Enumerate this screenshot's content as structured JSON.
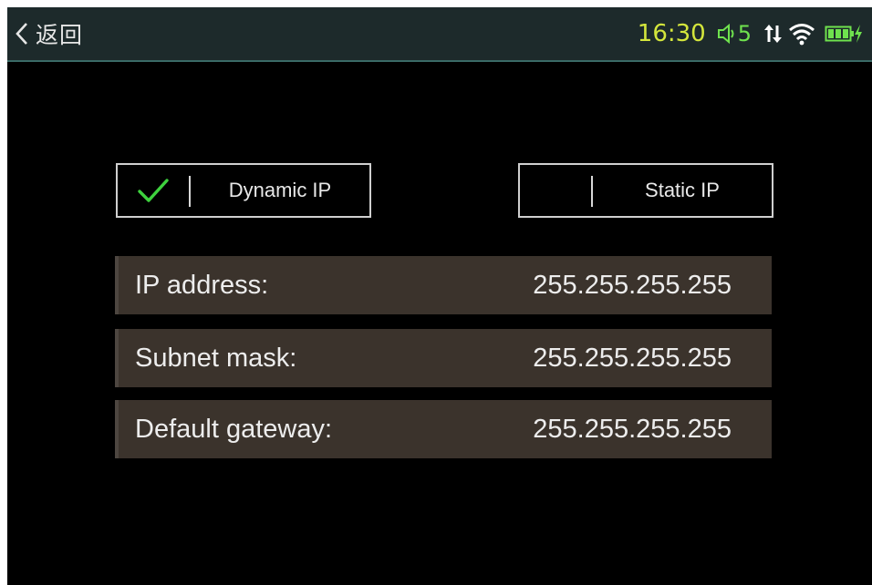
{
  "status_bar": {
    "back_label": "返回",
    "time": "16:30",
    "volume_level": "5",
    "icons": [
      "back-chevron-icon",
      "volume-icon",
      "data-transfer-icon",
      "wifi-icon",
      "battery-charging-icon"
    ],
    "colors": {
      "time": "#d4e63c",
      "accent": "#6fe24e",
      "bar_bg": "#1d2a2b"
    }
  },
  "mode": {
    "dynamic_label": "Dynamic IP",
    "static_label": "Static IP",
    "selected": "Dynamic IP"
  },
  "network": {
    "rows": [
      {
        "label": "IP address:",
        "value": "255.255.255.255"
      },
      {
        "label": "Subnet mask:",
        "value": "255.255.255.255"
      },
      {
        "label": "Default gateway:",
        "value": "255.255.255.255"
      }
    ]
  }
}
